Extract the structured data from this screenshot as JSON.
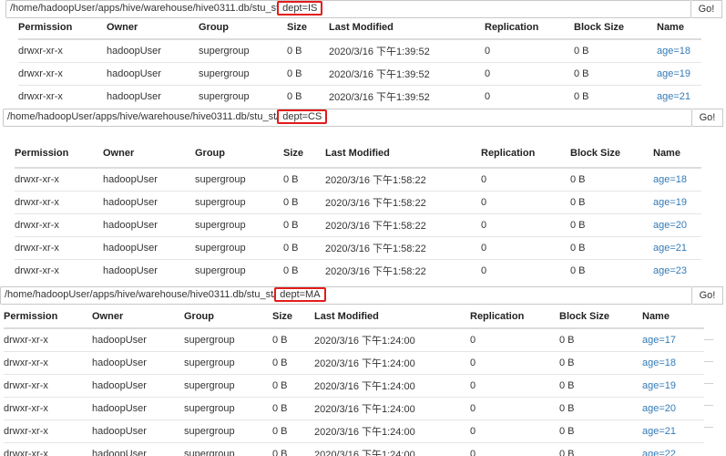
{
  "columns": [
    "Permission",
    "Owner",
    "Group",
    "Size",
    "Last Modified",
    "Replication",
    "Block Size",
    "Name"
  ],
  "go_label": "Go!",
  "panels": [
    {
      "path_prefix": "/home/hadoopUser/apps/hive/warehouse/hive0311.db/stu_st",
      "path_highlight": "dept=IS",
      "rows": [
        [
          "drwxr-xr-x",
          "hadoopUser",
          "supergroup",
          "0 B",
          "2020/3/16 下午1:39:52",
          "0",
          "0 B",
          "age=18"
        ],
        [
          "drwxr-xr-x",
          "hadoopUser",
          "supergroup",
          "0 B",
          "2020/3/16 下午1:39:52",
          "0",
          "0 B",
          "age=19"
        ],
        [
          "drwxr-xr-x",
          "hadoopUser",
          "supergroup",
          "0 B",
          "2020/3/16 下午1:39:52",
          "0",
          "0 B",
          "age=21"
        ]
      ]
    },
    {
      "path_prefix": "/home/hadoopUser/apps/hive/warehouse/hive0311.db/stu_st/",
      "path_highlight": "dept=CS",
      "rows": [
        [
          "drwxr-xr-x",
          "hadoopUser",
          "supergroup",
          "0 B",
          "2020/3/16 下午1:58:22",
          "0",
          "0 B",
          "age=18"
        ],
        [
          "drwxr-xr-x",
          "hadoopUser",
          "supergroup",
          "0 B",
          "2020/3/16 下午1:58:22",
          "0",
          "0 B",
          "age=19"
        ],
        [
          "drwxr-xr-x",
          "hadoopUser",
          "supergroup",
          "0 B",
          "2020/3/16 下午1:58:22",
          "0",
          "0 B",
          "age=20"
        ],
        [
          "drwxr-xr-x",
          "hadoopUser",
          "supergroup",
          "0 B",
          "2020/3/16 下午1:58:22",
          "0",
          "0 B",
          "age=21"
        ],
        [
          "drwxr-xr-x",
          "hadoopUser",
          "supergroup",
          "0 B",
          "2020/3/16 下午1:58:22",
          "0",
          "0 B",
          "age=23"
        ]
      ]
    },
    {
      "path_prefix": "/home/hadoopUser/apps/hive/warehouse/hive0311.db/stu_st/",
      "path_highlight": "dept=MA",
      "rows": [
        [
          "drwxr-xr-x",
          "hadoopUser",
          "supergroup",
          "0 B",
          "2020/3/16 下午1:24:00",
          "0",
          "0 B",
          "age=17"
        ],
        [
          "drwxr-xr-x",
          "hadoopUser",
          "supergroup",
          "0 B",
          "2020/3/16 下午1:24:00",
          "0",
          "0 B",
          "age=18"
        ],
        [
          "drwxr-xr-x",
          "hadoopUser",
          "supergroup",
          "0 B",
          "2020/3/16 下午1:24:00",
          "0",
          "0 B",
          "age=19"
        ],
        [
          "drwxr-xr-x",
          "hadoopUser",
          "supergroup",
          "0 B",
          "2020/3/16 下午1:24:00",
          "0",
          "0 B",
          "age=20"
        ],
        [
          "drwxr-xr-x",
          "hadoopUser",
          "supergroup",
          "0 B",
          "2020/3/16 下午1:24:00",
          "0",
          "0 B",
          "age=21"
        ],
        [
          "drwxr-xr-x",
          "hadoopUser",
          "supergroup",
          "0 B",
          "2020/3/16 下午1:24:00",
          "0",
          "0 B",
          "age=22"
        ]
      ]
    }
  ]
}
